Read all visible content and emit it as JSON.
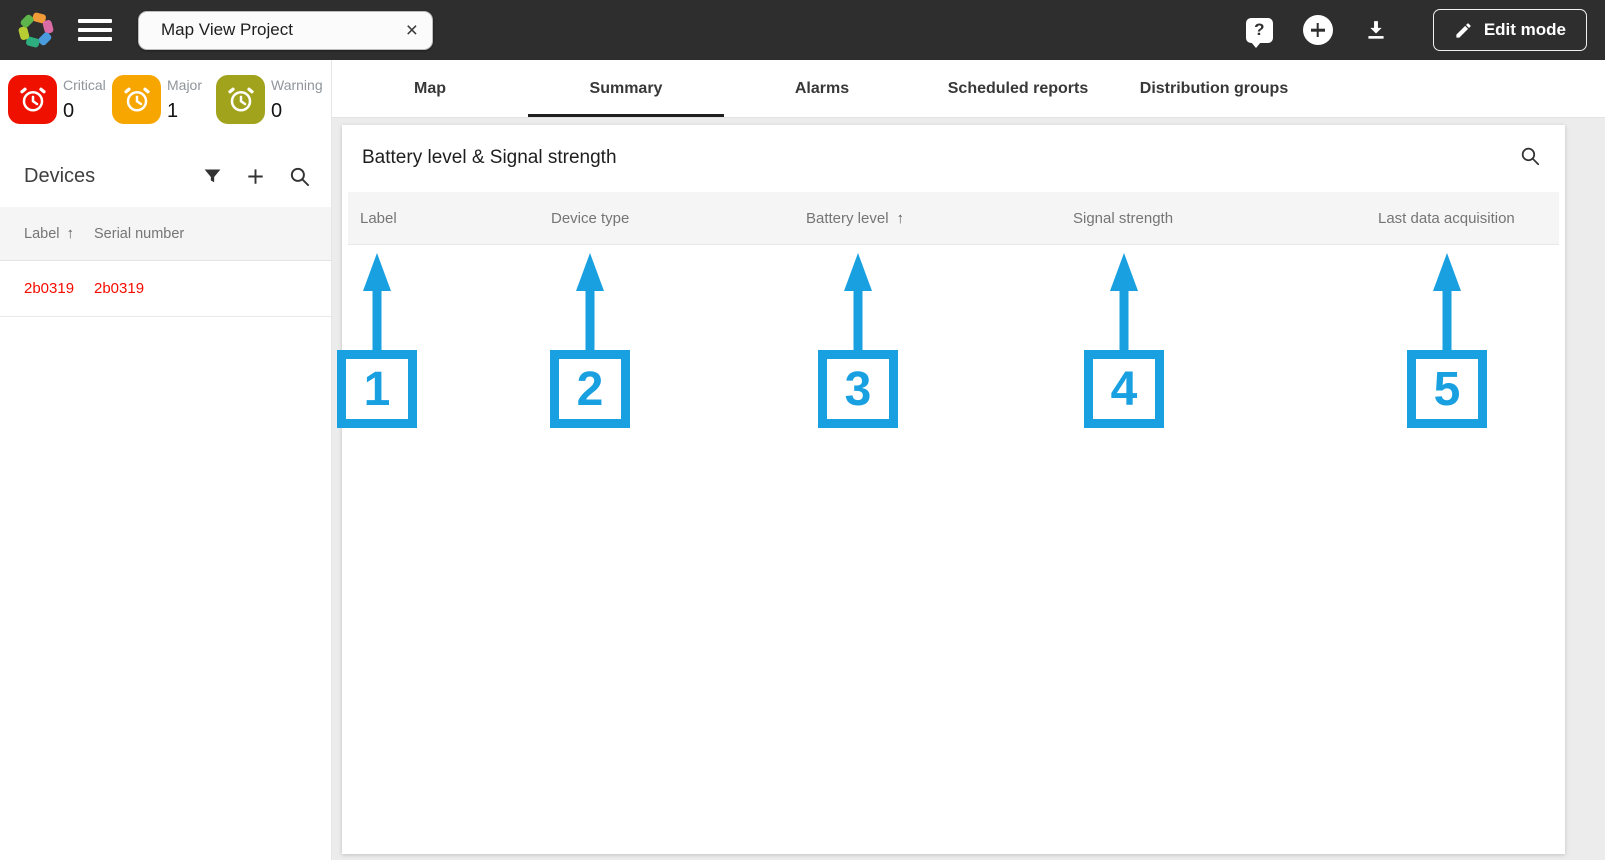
{
  "topbar": {
    "project_name": "Map View Project",
    "clear_icon_glyph": "×",
    "help_glyph": "?",
    "edit_mode_label": "Edit mode"
  },
  "sidebar": {
    "alarms": [
      {
        "label": "Critical",
        "count": "0",
        "color": "#F01000"
      },
      {
        "label": "Major",
        "count": "1",
        "color": "#F7A600"
      },
      {
        "label": "Warning",
        "count": "0",
        "color": "#A2A31C"
      }
    ],
    "devices_panel": {
      "title": "Devices",
      "sort_indicator": "↑",
      "columns": [
        "Label",
        "Serial number"
      ],
      "rows": [
        {
          "label": "2b0319",
          "serial_number": "2b0319"
        }
      ],
      "row_text_color": "#F50B00"
    }
  },
  "tabs": [
    {
      "label": "Map",
      "active": false
    },
    {
      "label": "Summary",
      "active": true
    },
    {
      "label": "Alarms",
      "active": false
    },
    {
      "label": "Scheduled reports",
      "active": false
    },
    {
      "label": "Distribution groups",
      "active": false
    }
  ],
  "panel": {
    "title": "Battery level & Signal strength",
    "sort_indicator": "↑",
    "columns": [
      {
        "label": "Label"
      },
      {
        "label": "Device type"
      },
      {
        "label": "Battery level",
        "sorted": true
      },
      {
        "label": "Signal strength"
      },
      {
        "label": "Last data acquisition"
      }
    ]
  },
  "annotations": {
    "color": "#18A0E0",
    "items": [
      {
        "number": "1",
        "target": "Label"
      },
      {
        "number": "2",
        "target": "Device type"
      },
      {
        "number": "3",
        "target": "Battery level"
      },
      {
        "number": "4",
        "target": "Signal strength"
      },
      {
        "number": "5",
        "target": "Last data acquisition"
      }
    ]
  }
}
